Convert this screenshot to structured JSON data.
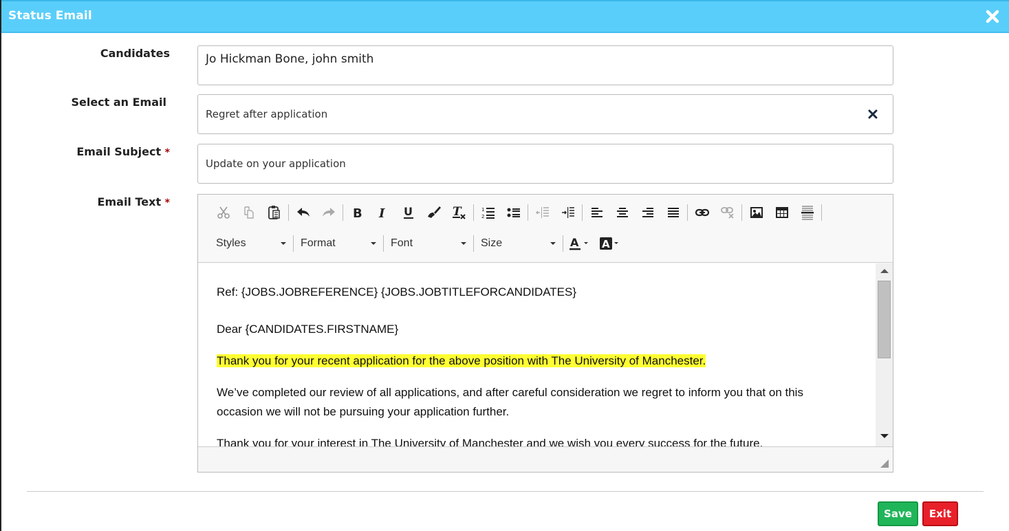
{
  "dialog": {
    "title": "Status Email",
    "close_icon": "close-icon"
  },
  "form": {
    "candidates": {
      "label": "Candidates",
      "value": "Jo Hickman Bone, john smith"
    },
    "select_email": {
      "label": "Select an Email",
      "value": "Regret after application",
      "clear_icon": "clear-icon"
    },
    "subject": {
      "label": "Email Subject",
      "required_mark": "*",
      "value": "Update on your application"
    },
    "email_text": {
      "label": "Email Text",
      "required_mark": "*"
    }
  },
  "editor": {
    "toolbar_row1": [
      {
        "icon": "cut-icon",
        "enabled": false
      },
      {
        "icon": "copy-icon",
        "enabled": false
      },
      {
        "icon": "paste-icon",
        "enabled": true
      },
      {
        "icon": "undo-icon",
        "enabled": true
      },
      {
        "icon": "redo-icon",
        "enabled": false
      },
      {
        "icon": "bold-icon",
        "enabled": true
      },
      {
        "icon": "italic-icon",
        "enabled": true
      },
      {
        "icon": "underline-icon",
        "enabled": true
      },
      {
        "icon": "format-painter-icon",
        "enabled": true
      },
      {
        "icon": "remove-format-icon",
        "enabled": true
      },
      {
        "icon": "numbered-list-icon",
        "enabled": true
      },
      {
        "icon": "bulleted-list-icon",
        "enabled": true
      },
      {
        "icon": "outdent-icon",
        "enabled": false
      },
      {
        "icon": "indent-icon",
        "enabled": true
      },
      {
        "icon": "align-left-icon",
        "enabled": true
      },
      {
        "icon": "align-center-icon",
        "enabled": true
      },
      {
        "icon": "align-right-icon",
        "enabled": true
      },
      {
        "icon": "justify-icon",
        "enabled": true
      },
      {
        "icon": "link-icon",
        "enabled": true
      },
      {
        "icon": "unlink-icon",
        "enabled": false
      },
      {
        "icon": "image-icon",
        "enabled": true
      },
      {
        "icon": "table-icon",
        "enabled": true
      },
      {
        "icon": "horizontal-rule-icon",
        "enabled": true
      }
    ],
    "combos": {
      "styles": "Styles",
      "format": "Format",
      "font": "Font",
      "size": "Size"
    },
    "text_color_icon": "text-color-icon",
    "bg_color_icon": "background-color-icon",
    "content": {
      "ref_line": "Ref: {JOBS.JOBREFERENCE} {JOBS.JOBTITLEFORCANDIDATES}",
      "greeting": "Dear {CANDIDATES.FIRSTNAME}",
      "para1_highlighted": "Thank you for your recent application for the above position with The University of Manchester.",
      "para2": "We’ve completed our review of all applications, and after careful consideration we regret to inform you that on this occasion we will not be pursuing your application further.",
      "para3": "Thank you for your interest in The University of Manchester and we wish you every success for the future."
    },
    "highlight_color": "#ffff33"
  },
  "footer": {
    "save_label": "Save",
    "exit_label": "Exit",
    "save_color": "#21b55a",
    "exit_color": "#e8202a"
  },
  "colors": {
    "titlebar": "#5acefa",
    "required": "#aa0000"
  }
}
